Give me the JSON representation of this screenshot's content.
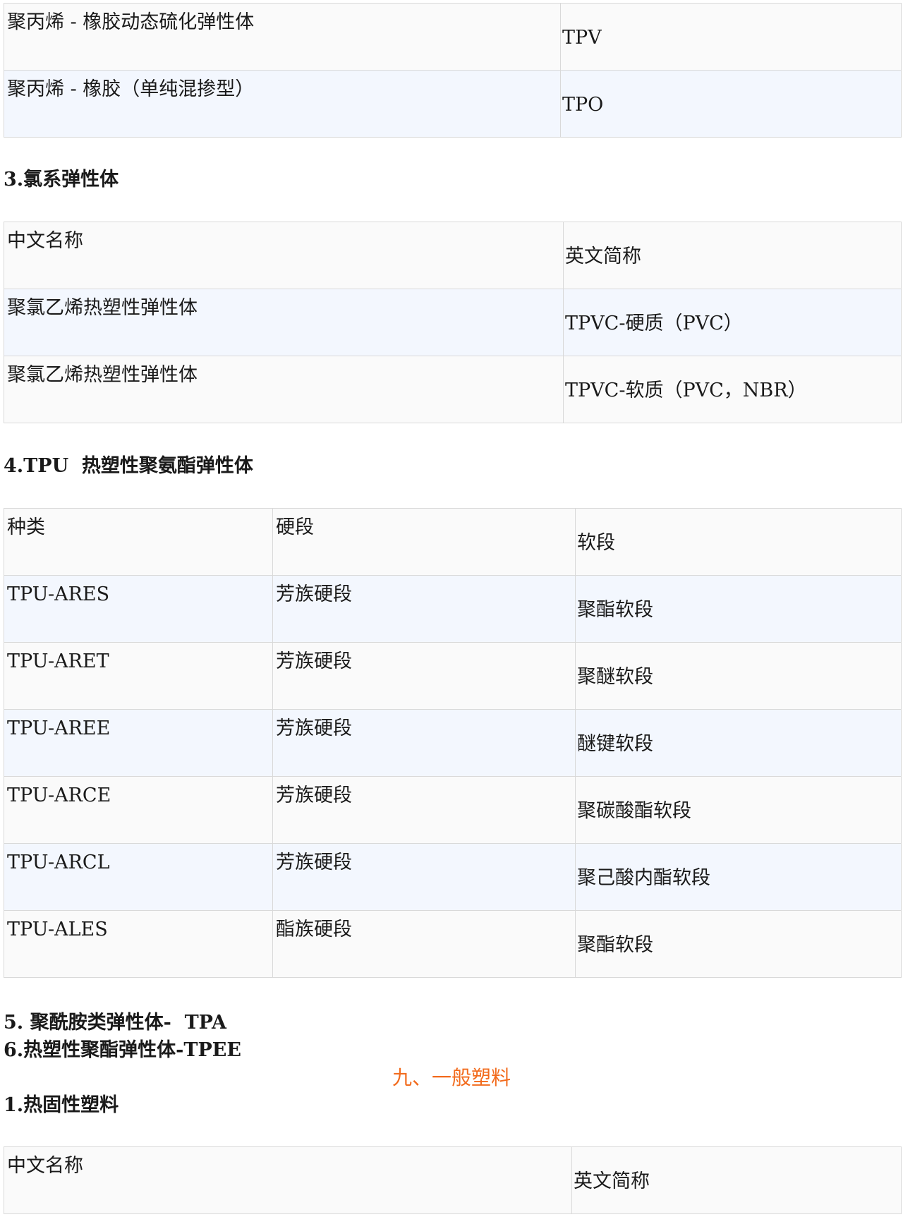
{
  "table1": {
    "rows": [
      [
        "聚丙烯 - 橡胶动态硫化弹性体",
        "TPV"
      ],
      [
        "聚丙烯 - 橡胶（单纯混掺型）",
        "TPO"
      ]
    ]
  },
  "section3": {
    "heading": "3.氯系弹性体",
    "header": [
      "中文名称",
      "英文简称"
    ],
    "rows": [
      [
        "聚氯乙烯热塑性弹性体",
        "TPVC-硬质（PVC）"
      ],
      [
        "聚氯乙烯热塑性弹性体",
        "TPVC-软质（PVC，NBR）"
      ]
    ]
  },
  "section4": {
    "heading": "4.TPU  热塑性聚氨酯弹性体",
    "header": [
      "种类",
      "硬段",
      "软段"
    ],
    "rows": [
      [
        "TPU-ARES",
        "芳族硬段",
        "聚酯软段"
      ],
      [
        "TPU-ARET",
        "芳族硬段",
        "聚醚软段"
      ],
      [
        "TPU-AREE",
        "芳族硬段",
        "醚键软段"
      ],
      [
        "TPU-ARCE",
        "芳族硬段",
        "聚碳酸酯软段"
      ],
      [
        "TPU-ARCL",
        "芳族硬段",
        "聚己酸内酯软段"
      ],
      [
        "TPU-ALES",
        "酯族硬段",
        "聚酯软段"
      ]
    ]
  },
  "section5": {
    "heading": "5. 聚酰胺类弹性体-  TPA"
  },
  "section6": {
    "heading": "6.热塑性聚酯弹性体-TPEE"
  },
  "chapter9": {
    "title": "九、一般塑料"
  },
  "section9_1": {
    "heading": "1.热固性塑料",
    "header": [
      "中文名称",
      "英文简称"
    ]
  }
}
